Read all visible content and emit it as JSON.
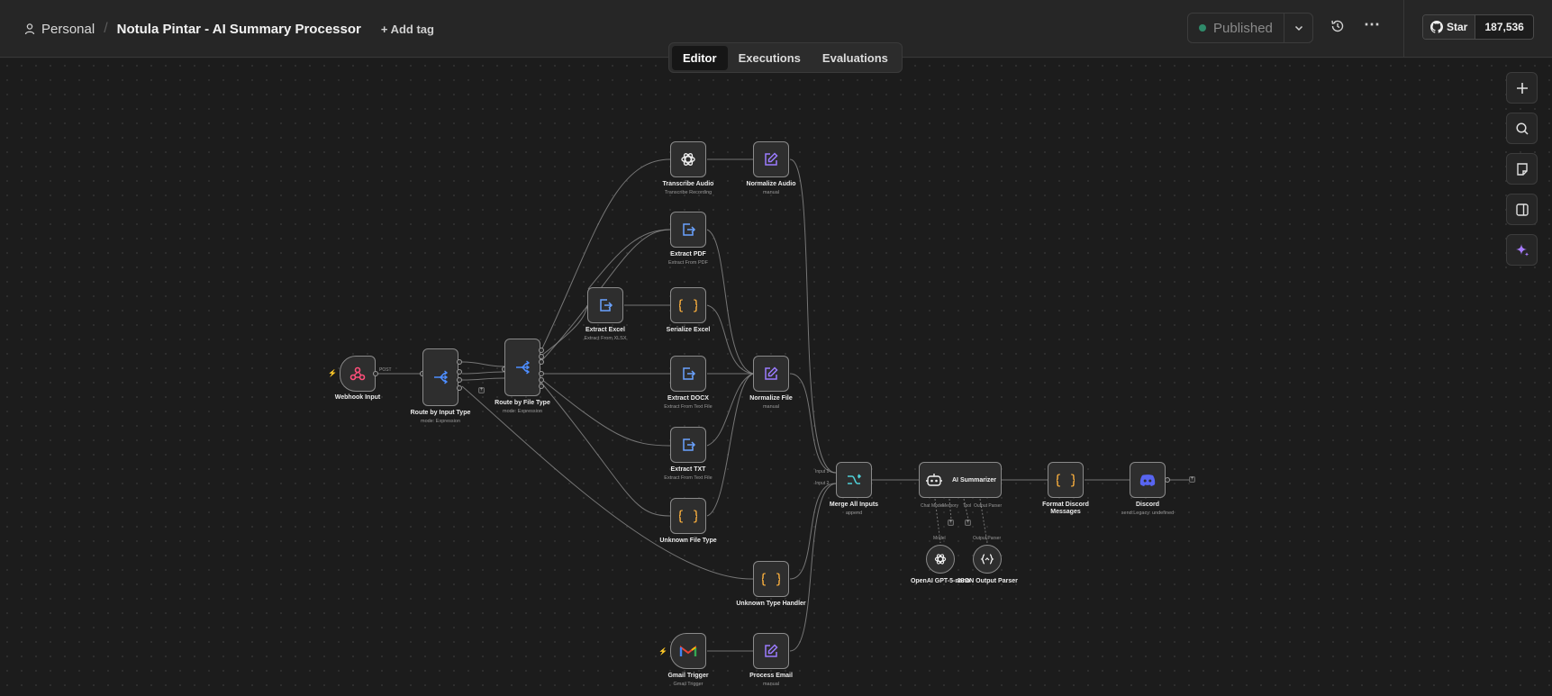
{
  "header": {
    "breadcrumb_personal": "Personal",
    "breadcrumb_separator": "/",
    "workflow_title": "Notula Pintar - AI Summary Processor",
    "add_tag": "+ Add tag",
    "publish_label": "Published",
    "github_star_label": "Star",
    "github_star_count": "187,536"
  },
  "tabs": [
    {
      "label": "Editor",
      "active": true
    },
    {
      "label": "Executions",
      "active": false
    },
    {
      "label": "Evaluations",
      "active": false
    }
  ],
  "nodes": {
    "webhook_input": {
      "label": "Webhook Input",
      "port": "POST",
      "icon": "webhook-icon"
    },
    "route_input_type": {
      "label": "Route by Input Type",
      "sub": "mode: Expression",
      "icon": "switch-icon"
    },
    "route_file_type": {
      "label": "Route by File Type",
      "sub": "mode: Expression",
      "icon": "switch-icon"
    },
    "transcribe_audio": {
      "label": "Transcribe Audio",
      "sub": "Transcribe Recording",
      "icon": "openai-icon"
    },
    "normalize_audio": {
      "label": "Normalize Audio",
      "sub": "manual",
      "icon": "edit-icon"
    },
    "extract_pdf": {
      "label": "Extract PDF",
      "sub": "Extract From PDF",
      "icon": "extract-icon"
    },
    "extract_excel": {
      "label": "Extract Excel",
      "sub": "Extract From XLSX",
      "icon": "extract-icon"
    },
    "serialize_excel": {
      "label": "Serialize Excel",
      "icon": "code-icon"
    },
    "extract_docx": {
      "label": "Extract DOCX",
      "sub": "Extract From Text File",
      "icon": "extract-icon"
    },
    "normalize_file": {
      "label": "Normalize File",
      "sub": "manual",
      "icon": "edit-icon"
    },
    "extract_txt": {
      "label": "Extract TXT",
      "sub": "Extract From Text File",
      "icon": "extract-icon"
    },
    "unknown_file_type": {
      "label": "Unknown File Type",
      "icon": "code-icon"
    },
    "unknown_type_handler": {
      "label": "Unknown Type Handler",
      "icon": "code-icon"
    },
    "gmail_trigger": {
      "label": "Gmail Trigger",
      "sub": "Gmail Trigger",
      "icon": "gmail-icon"
    },
    "process_email": {
      "label": "Process Email",
      "sub": "manual",
      "icon": "edit-icon"
    },
    "merge_all_inputs": {
      "label": "Merge All Inputs",
      "sub": "append",
      "input1": "Input 1",
      "input2": "Input 2",
      "icon": "merge-icon"
    },
    "ai_summarizer": {
      "label": "AI Summarizer",
      "port_chat_model": "Chat Model",
      "port_memory": "Memory",
      "port_tool": "Tool",
      "port_output_parser": "Output Parser",
      "icon": "robot-icon"
    },
    "openai_model": {
      "label": "OpenAI GPT-5-nano",
      "port": "Model",
      "icon": "openai-icon"
    },
    "json_output_parser": {
      "label": "JSON Output Parser",
      "port": "Output Parser",
      "icon": "parser-icon"
    },
    "format_discord": {
      "label_line1": "Format Discord",
      "label_line2": "Messages",
      "icon": "code-icon"
    },
    "discord": {
      "label": "Discord",
      "sub": "send:Legacy: undefined",
      "icon": "discord-icon"
    }
  },
  "toolbar": [
    "zoom-plus-icon",
    "search-icon",
    "sticky-note-icon",
    "panel-icon",
    "sparkle-icon"
  ],
  "colors": {
    "background": "#1c1c1c",
    "switch": "#4d8dff",
    "edit": "#9b7bff",
    "code": "#ffb23e",
    "webhook": "#ff4f7b",
    "discord": "#5865f2",
    "published_dot": "#2f8a6a"
  }
}
